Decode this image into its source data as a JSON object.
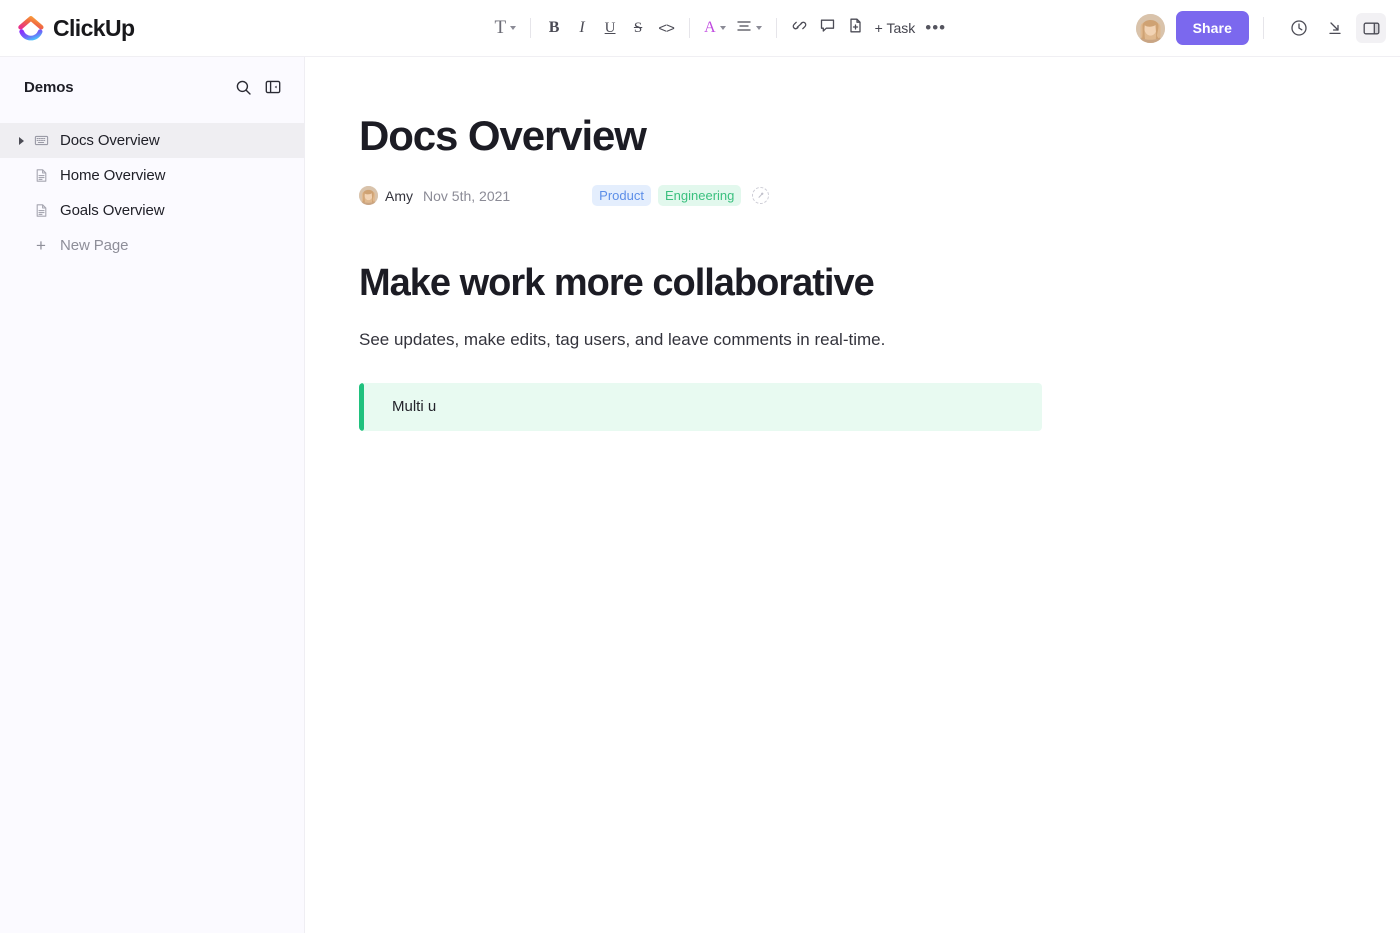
{
  "app": {
    "brand_name": "ClickUp",
    "brand_logo_icon": "clickup-logo-icon"
  },
  "toolbar": {
    "groups": [
      {
        "items": [
          {
            "name": "text-style-dropdown",
            "icon": "text-style-icon",
            "glyph": "T",
            "caret": true
          }
        ]
      },
      {
        "items": [
          {
            "name": "bold-button",
            "icon": "bold-icon",
            "glyph": "B"
          },
          {
            "name": "italic-button",
            "icon": "italic-icon",
            "glyph": "I"
          },
          {
            "name": "underline-button",
            "icon": "underline-icon",
            "glyph": "U"
          },
          {
            "name": "strikethrough-button",
            "icon": "strikethrough-icon",
            "glyph": "S"
          },
          {
            "name": "code-button",
            "icon": "code-icon",
            "glyph": "<>"
          }
        ]
      },
      {
        "items": [
          {
            "name": "font-color-dropdown",
            "icon": "font-color-icon",
            "glyph": "A",
            "caret": true
          },
          {
            "name": "align-dropdown",
            "icon": "align-icon",
            "caret": true
          }
        ]
      },
      {
        "items": [
          {
            "name": "link-button",
            "icon": "link-icon"
          },
          {
            "name": "comment-button",
            "icon": "comment-bubble-icon"
          },
          {
            "name": "page-button",
            "icon": "page-plus-icon"
          },
          {
            "name": "add-task-button",
            "icon": "plus-icon",
            "label": "+ Task"
          },
          {
            "name": "more-options-button",
            "icon": "ellipsis-icon",
            "label": "•••"
          }
        ]
      }
    ],
    "task_label": "+ Task",
    "more_label": "•••"
  },
  "topright": {
    "avatar_name": "user-avatar",
    "share_label": "Share",
    "share_color": "#7b68ee",
    "icons": [
      {
        "name": "history-clock-icon",
        "active": false
      },
      {
        "name": "collapse-arrow-icon",
        "active": false
      },
      {
        "name": "toggle-right-panel-icon",
        "active": true
      }
    ]
  },
  "sidebar": {
    "title": "Demos",
    "search_icon": "search-icon",
    "collapse_icon": "collapse-sidebar-icon",
    "items": [
      {
        "label": "Docs Overview",
        "icon": "book-icon",
        "selected": true,
        "has_arrow": true
      },
      {
        "label": "Home Overview",
        "icon": "document-icon",
        "selected": false,
        "has_arrow": false
      },
      {
        "label": "Goals Overview",
        "icon": "document-icon",
        "selected": false,
        "has_arrow": false
      }
    ],
    "new_page_label": "New Page",
    "new_page_icon": "plus-icon"
  },
  "document": {
    "title": "Docs Overview",
    "author": "Amy",
    "date": "Nov 5th, 2021",
    "tags": [
      {
        "label": "Product",
        "bg": "#e4eefd",
        "color": "#5c8ee8"
      },
      {
        "label": "Engineering",
        "bg": "#e2f8ed",
        "color": "#3bc07f"
      }
    ],
    "add_tag_icon": "add-tag-icon",
    "heading": "Make work more collaborative",
    "paragraph": "See updates, make edits, tag users, and leave comments in real-time.",
    "callout": {
      "text": "Multi u",
      "bar_color": "#20c17e",
      "bg_color": "#e8faf1"
    }
  }
}
